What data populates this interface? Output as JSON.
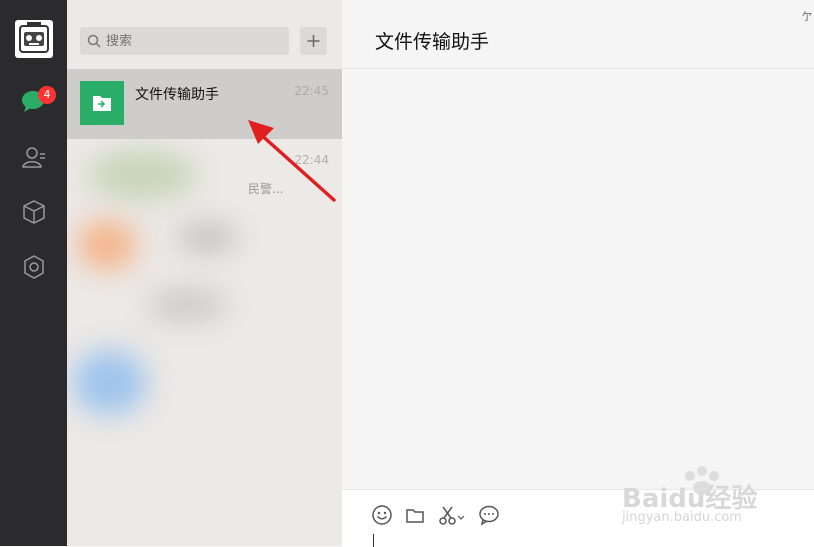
{
  "sidebar": {
    "icons": [
      "avatar",
      "chat-icon",
      "contacts-icon",
      "favorites-icon",
      "settings-icon"
    ],
    "chat_badge": "4"
  },
  "search": {
    "placeholder": "搜索"
  },
  "chat_list": {
    "items": [
      {
        "name": "文件传输助手",
        "time": "22:45"
      },
      {
        "time": "22:44",
        "preview": "民警..."
      }
    ]
  },
  "main": {
    "title": "文件传输助手",
    "pin_glyph": "亇"
  },
  "composer": {
    "tools": [
      "emoji-icon",
      "folder-icon",
      "scissors-icon",
      "chat-bubble-icon"
    ]
  },
  "watermark": {
    "brand": "Baidu经验",
    "url": "jingyan.baidu.com"
  },
  "colors": {
    "sidebar": "#2b2b2e",
    "list_bg": "#ece9e7",
    "selected": "#cfcdcb",
    "accent_green": "#2aae67",
    "badge_red": "#f33",
    "arrow_red": "#e02020"
  }
}
